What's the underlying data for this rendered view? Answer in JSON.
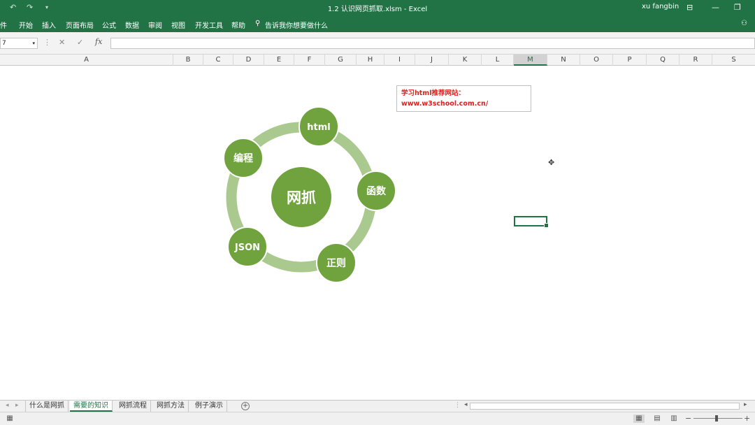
{
  "window": {
    "title": "1.2 认识网页抓取.xlsm  -  Excel",
    "user": "xu fangbin"
  },
  "ribbon": {
    "tabs": [
      "件",
      "开始",
      "插入",
      "页面布局",
      "公式",
      "数据",
      "审阅",
      "视图",
      "开发工具",
      "帮助"
    ],
    "tell_me": "告诉我你想要做什么"
  },
  "formula_bar": {
    "name_box": "7",
    "fx": "fx",
    "value": ""
  },
  "columns": [
    "A",
    "B",
    "C",
    "D",
    "E",
    "F",
    "G",
    "H",
    "I",
    "J",
    "K",
    "L",
    "M",
    "N",
    "O",
    "P",
    "Q",
    "R",
    "S"
  ],
  "active_column": "M",
  "textbox": {
    "line1": "学习html推荐网站：",
    "line2": "www.w3school.com.cn/"
  },
  "diagram": {
    "center": "网抓",
    "nodes": [
      "html",
      "函数",
      "正则",
      "JSON",
      "编程"
    ],
    "fill_color": "#70a33e",
    "ring_color": "#a9c98f"
  },
  "sheets": {
    "tabs": [
      "什么是网抓",
      "需要的知识",
      "网抓流程",
      "网抓方法",
      "例子演示"
    ],
    "active": "需要的知识"
  },
  "colors": {
    "excel_green": "#217346",
    "link_red": "#e0201b"
  }
}
